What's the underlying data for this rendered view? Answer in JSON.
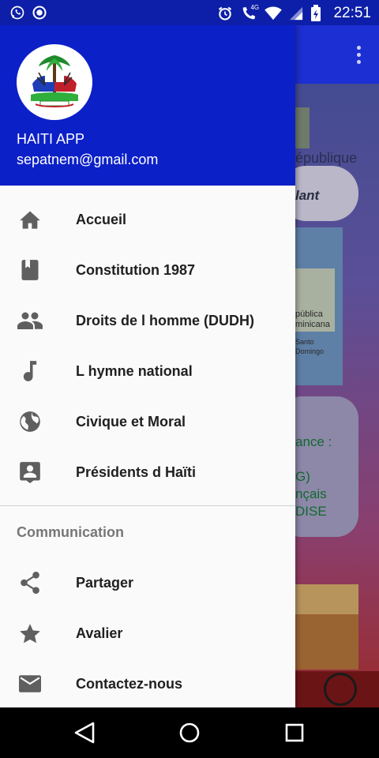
{
  "status_bar": {
    "time": "22:51",
    "network": "4G"
  },
  "drawer": {
    "app_name": "HAITI APP",
    "email": "sepatnem@gmail.com",
    "items": [
      {
        "label": "Accueil",
        "icon": "home-icon"
      },
      {
        "label": "Constitution 1987",
        "icon": "book-icon"
      },
      {
        "label": "Droits de l homme (DUDH)",
        "icon": "people-icon"
      },
      {
        "label": "L hymne national",
        "icon": "music-note-icon"
      },
      {
        "label": "Civique et Moral",
        "icon": "globe-icon"
      },
      {
        "label": "Présidents d Haïti",
        "icon": "contact-card-icon"
      }
    ],
    "section_title": "Communication",
    "comm_items": [
      {
        "label": "Partager",
        "icon": "share-icon"
      },
      {
        "label": "Avalier",
        "icon": "star-icon"
      },
      {
        "label": "Contactez-nous",
        "icon": "mail-icon"
      }
    ]
  },
  "background_app": {
    "republic_text": "épublique",
    "pill_text": "lant",
    "map_text_1": "pública",
    "map_text_2": "minicana",
    "map_text_3": "Santo",
    "map_text_4": "Domingo",
    "card_line_1": "ance :",
    "card_line_2": "G)",
    "card_line_3": "nçais",
    "card_line_4": "DISE"
  },
  "colors": {
    "header_blue": "#0c20c8",
    "status_blue": "#0d1fa8",
    "icon_gray": "#5f5f5f"
  }
}
